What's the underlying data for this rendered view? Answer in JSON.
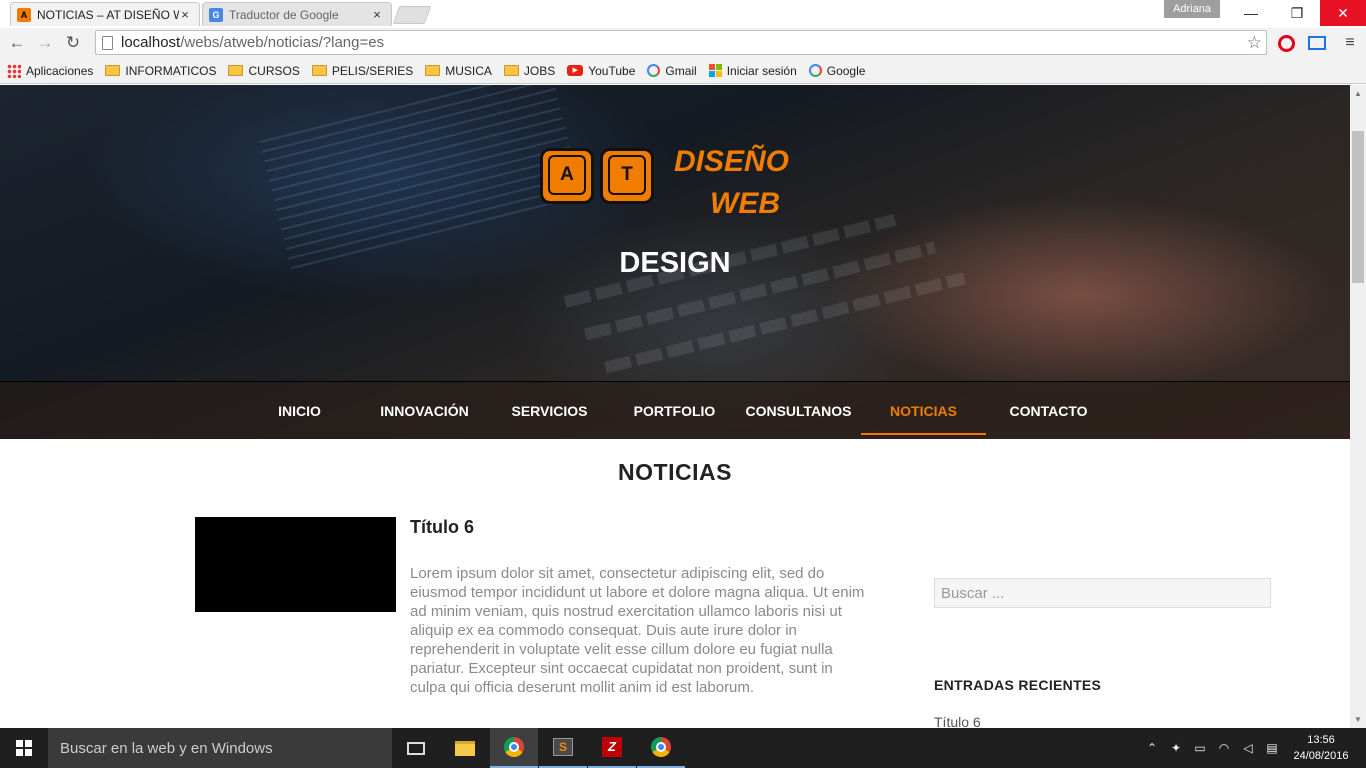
{
  "browser": {
    "tabs": [
      {
        "title": "NOTICIAS – AT DISEÑO W",
        "icon": "at-favicon",
        "close": "×"
      },
      {
        "title": "Traductor de Google",
        "icon": "google-translate-favicon",
        "close": "×"
      }
    ],
    "user": "Adriana",
    "window_controls": {
      "minimize": "—",
      "maximize": "❐",
      "close": "✕"
    },
    "nav": {
      "back": "←",
      "forward": "→",
      "reload": "↻"
    },
    "url": {
      "host": "localhost",
      "path": "/webs/atweb/noticias/?lang=es"
    },
    "bookmarks": [
      {
        "label": "Aplicaciones",
        "icon": "apps-icon"
      },
      {
        "label": "INFORMATICOS",
        "icon": "folder-icon"
      },
      {
        "label": "CURSOS",
        "icon": "folder-icon"
      },
      {
        "label": "PELIS/SERIES",
        "icon": "folder-icon"
      },
      {
        "label": "MUSICA",
        "icon": "folder-icon"
      },
      {
        "label": "JOBS",
        "icon": "folder-icon"
      },
      {
        "label": "YouTube",
        "icon": "youtube-icon"
      },
      {
        "label": "Gmail",
        "icon": "google-icon"
      },
      {
        "label": "Iniciar sesión",
        "icon": "microsoft-icon"
      },
      {
        "label": "Google",
        "icon": "google-icon"
      }
    ]
  },
  "site": {
    "logo": {
      "key_a": "A",
      "key_t": "T",
      "line1": "DISEÑO",
      "line2": "WEB"
    },
    "hero_title": "DESIGN",
    "nav": [
      {
        "label": "INICIO",
        "active": false
      },
      {
        "label": "INNOVACIÓN",
        "active": false
      },
      {
        "label": "SERVICIOS",
        "active": false
      },
      {
        "label": "PORTFOLIO",
        "active": false
      },
      {
        "label": "CONSULTANOS",
        "active": false
      },
      {
        "label": "NOTICIAS",
        "active": true
      },
      {
        "label": "CONTACTO",
        "active": false
      }
    ],
    "accent_color": "#f07c00",
    "page_title": "NOTICIAS",
    "post": {
      "title": "Título 6",
      "excerpt": "Lorem ipsum dolor sit amet, consectetur adipiscing elit, sed do eiusmod tempor incididunt ut labore et dolore magna aliqua. Ut enim ad minim veniam, quis nostrud exercitation ullamco laboris nisi ut aliquip ex ea commodo consequat. Duis aute irure dolor in reprehenderit in voluptate velit esse cillum dolore eu fugiat nulla pariatur. Excepteur sint occaecat cupidatat non proident, sunt in culpa qui officia deserunt mollit anim id est laborum."
    },
    "sidebar": {
      "search_placeholder": "Buscar ...",
      "recent_title": "ENTRADAS RECIENTES",
      "recent_items": [
        "Título 6"
      ]
    }
  },
  "taskbar": {
    "search_text": "Buscar en la web y en Windows",
    "apps": [
      "task-view",
      "file-explorer",
      "chrome",
      "sublime-text",
      "filezilla",
      "chrome"
    ],
    "time": "13:56",
    "date": "24/08/2016"
  }
}
